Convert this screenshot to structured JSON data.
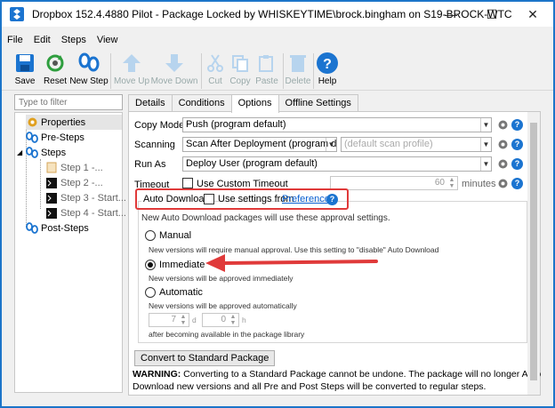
{
  "window": {
    "title": "Dropbox 152.4.4880 Pilot - Package Locked by WHISKEYTIME\\brock.bingham on S19-BROCK-WTC",
    "minimize": "—",
    "maximize": "☐",
    "close": "✕"
  },
  "menu": [
    "File",
    "Edit",
    "Steps",
    "View"
  ],
  "toolbar": {
    "save": "Save",
    "reset": "Reset",
    "new_step": "New Step",
    "move_up": "Move Up",
    "move_down": "Move Down",
    "cut": "Cut",
    "copy": "Copy",
    "paste": "Paste",
    "delete": "Delete",
    "help": "Help"
  },
  "sidebar": {
    "filter_placeholder": "Type to filter",
    "items": [
      {
        "label": "Properties",
        "icon": "gear-icon"
      },
      {
        "label": "Pre-Steps",
        "icon": "footprints-icon"
      },
      {
        "label": "Steps",
        "icon": "footprints-icon"
      },
      {
        "label": "Step 1 -...",
        "icon": "file-icon"
      },
      {
        "label": "Step 2 -...",
        "icon": "terminal-icon"
      },
      {
        "label": "Step 3 - Start...",
        "icon": "terminal-icon"
      },
      {
        "label": "Step 4 - Start...",
        "icon": "terminal-icon"
      },
      {
        "label": "Post-Steps",
        "icon": "footprints-icon"
      }
    ]
  },
  "tabs": [
    "Details",
    "Conditions",
    "Options",
    "Offline Settings"
  ],
  "active_tab": "Options",
  "options": {
    "copy_mode_label": "Copy Mode",
    "copy_mode_value": "Push (program default)",
    "scanning_label": "Scanning",
    "scanning_value": "Scan After Deployment (program d...",
    "scan_profile_placeholder": "(default scan profile)",
    "run_as_label": "Run As",
    "run_as_value": "Deploy User (program default)",
    "timeout_label": "Timeout",
    "use_custom_timeout": "Use Custom Timeout",
    "timeout_value": "60",
    "timeout_unit": "minutes",
    "auto_download_label": "Auto Download",
    "use_settings_from": "Use settings from",
    "preferences_link": "Preferences",
    "approval_intro": "New Auto Download packages will use these approval settings.",
    "manual_label": "Manual",
    "manual_desc": "New versions will require manual approval. Use this setting to \"disable\" Auto Download",
    "immediate_label": "Immediate",
    "immediate_desc": "New versions will be approved immediately",
    "automatic_label": "Automatic",
    "automatic_desc": "New versions will be approved automatically",
    "days_value": "7",
    "days_unit": "d",
    "hours_value": "0",
    "hours_unit": "h",
    "after_text": "after becoming available in the package library",
    "convert_button": "Convert to Standard Package",
    "warning_bold": "WARNING:",
    "warning_line1": "Converting to a Standard Package cannot be undone. The package will no longer Auto",
    "warning_line2": "Download new versions and all Pre and Post Steps will be converted to regular steps.",
    "selected_approval": "Immediate"
  },
  "colors": {
    "accent": "#1b74d0",
    "annotation_red": "#e03a3a",
    "window_border": "#1c75c9"
  }
}
